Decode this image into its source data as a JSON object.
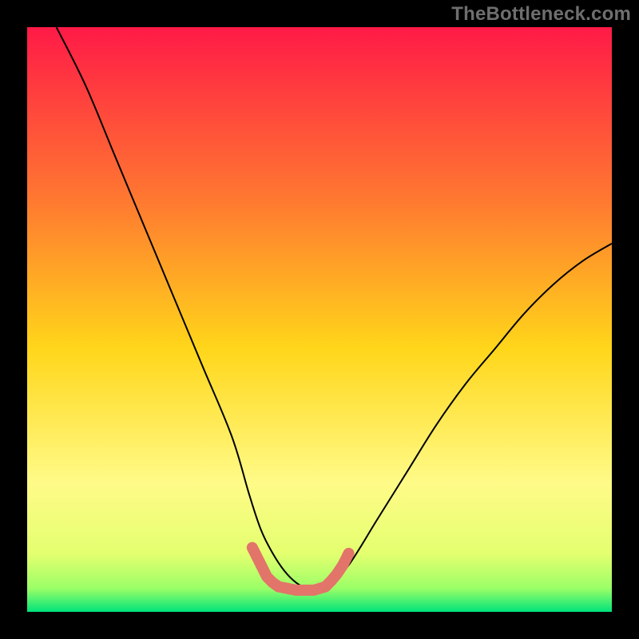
{
  "watermark": "TheBottleneck.com",
  "chart_data": {
    "type": "line",
    "title": "",
    "xlabel": "",
    "ylabel": "",
    "xlim": [
      0,
      100
    ],
    "ylim": [
      0,
      100
    ],
    "background_gradient": {
      "stops": [
        {
          "offset": 0.0,
          "color": "#ff1a47"
        },
        {
          "offset": 0.3,
          "color": "#ff7a30"
        },
        {
          "offset": 0.55,
          "color": "#ffd61a"
        },
        {
          "offset": 0.78,
          "color": "#fffb88"
        },
        {
          "offset": 0.9,
          "color": "#e4ff6f"
        },
        {
          "offset": 0.96,
          "color": "#9bff67"
        },
        {
          "offset": 1.0,
          "color": "#00e37a"
        }
      ]
    },
    "series": [
      {
        "name": "bottleneck-curve",
        "color": "#000000",
        "width": 2,
        "x": [
          5,
          10,
          15,
          20,
          25,
          30,
          35,
          38,
          40,
          42,
          44,
          46,
          48,
          50,
          52,
          55,
          60,
          65,
          70,
          75,
          80,
          85,
          90,
          95,
          100
        ],
        "values": [
          100,
          90,
          78,
          66,
          54,
          42,
          30,
          20,
          14,
          10,
          7,
          5,
          4,
          4,
          5,
          8,
          16,
          24,
          32,
          39,
          45,
          51,
          56,
          60,
          63
        ]
      },
      {
        "name": "highlight-optimal-left",
        "color": "#e2746a",
        "width": 14,
        "linecap": "round",
        "x": [
          38.5,
          40,
          41,
          42,
          43
        ],
        "values": [
          11,
          8,
          6,
          5,
          4.3
        ]
      },
      {
        "name": "highlight-optimal-bottom",
        "color": "#e2746a",
        "width": 14,
        "linecap": "round",
        "x": [
          43,
          46,
          49,
          51
        ],
        "values": [
          4.3,
          3.7,
          3.7,
          4.3
        ]
      },
      {
        "name": "highlight-optimal-right",
        "color": "#e2746a",
        "width": 14,
        "linecap": "round",
        "x": [
          51,
          52,
          53,
          54,
          55
        ],
        "values": [
          4.3,
          5.3,
          6.5,
          8,
          10
        ]
      }
    ]
  }
}
